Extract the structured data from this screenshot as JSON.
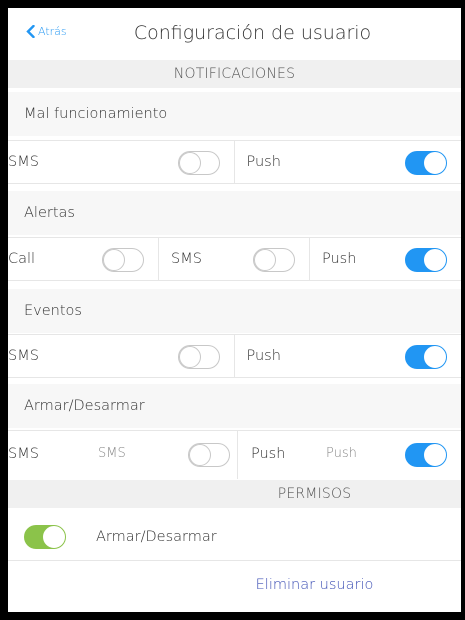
{
  "header": {
    "back_label": "Atrás",
    "title": "Configuración de usuario"
  },
  "notificaciones": {
    "section_title": "NOTIFICACIONES",
    "groups": [
      {
        "title": "Mal funcionamiento",
        "options": [
          {
            "label": "SMS",
            "state": "off"
          },
          {
            "label": "Push",
            "state": "on"
          }
        ]
      },
      {
        "title": "Alertas",
        "options": [
          {
            "label": "Call",
            "state": "off"
          },
          {
            "label": "SMS",
            "state": "off"
          },
          {
            "label": "Push",
            "state": "on"
          }
        ]
      },
      {
        "title": "Eventos",
        "options": [
          {
            "label": "SMS",
            "state": "off"
          },
          {
            "label": "Push",
            "state": "on"
          }
        ]
      },
      {
        "title": "Armar/Desarmar",
        "options": [
          {
            "label": "SMS",
            "state": "off"
          },
          {
            "label": "Push",
            "state": "on"
          }
        ]
      }
    ]
  },
  "permisos": {
    "section_title": "PERMISOS",
    "items": [
      {
        "label": "Armar/Desarmar",
        "state": "on"
      }
    ]
  },
  "delete_label": "Eliminar usuario",
  "colors": {
    "accent_blue": "#2196f3",
    "toggle_green": "#8bc34a",
    "link": "#3f51b5"
  }
}
